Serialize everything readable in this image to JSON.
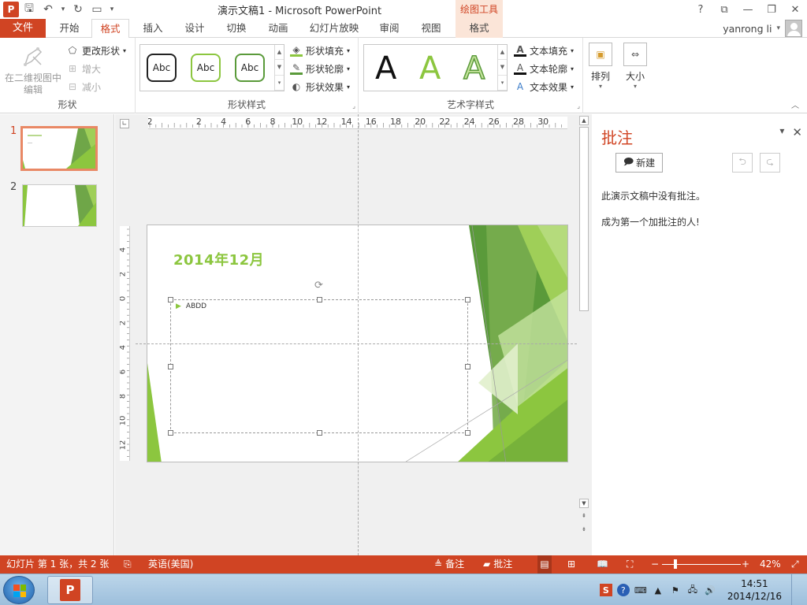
{
  "titlebar": {
    "app_icon": "P",
    "title": "演示文稿1 - Microsoft PowerPoint",
    "context_label": "绘图工具",
    "qat_icons": [
      "save-icon",
      "undo-icon",
      "redo-icon",
      "slideshow-icon",
      "customize-icon"
    ],
    "window_controls": [
      "?",
      "⧉",
      "—",
      "❐",
      "✕"
    ]
  },
  "tabs": {
    "file": "文件",
    "items": [
      "开始",
      "格式",
      "插入",
      "设计",
      "切换",
      "动画",
      "幻灯片放映",
      "审阅",
      "视图",
      "格式"
    ],
    "user": "yanrong li"
  },
  "ribbon": {
    "shape_group": {
      "edit_3d": "在二维视图中编辑",
      "change_shape": "更改形状",
      "increase": "增大",
      "decrease": "减小",
      "label": "形状"
    },
    "shape_styles": {
      "samples": [
        "Abc",
        "Abc",
        "Abc"
      ],
      "fill": "形状填充",
      "outline": "形状轮廓",
      "effects": "形状效果",
      "label": "形状样式"
    },
    "wordart": {
      "samples": [
        "A",
        "A",
        "A"
      ],
      "text_fill": "文本填充",
      "text_outline": "文本轮廓",
      "text_effects": "文本效果",
      "label": "艺术字样式"
    },
    "arrange": "排列",
    "size": "大小"
  },
  "thumbnails": {
    "numbers": [
      "1",
      "2"
    ]
  },
  "slide": {
    "date": "2014年12月",
    "bullet_text": "ABDD"
  },
  "ruler": {
    "h_labels": [
      "2",
      "2",
      "4",
      "6",
      "8",
      "10",
      "12",
      "14",
      "16",
      "18",
      "20",
      "22",
      "24",
      "26",
      "28",
      "30"
    ],
    "v_labels": [
      "4",
      "2",
      "0",
      "2",
      "4",
      "6",
      "8",
      "10",
      "12"
    ]
  },
  "comments": {
    "title": "批注",
    "new_label": "新建",
    "empty_line1": "此演示文稿中没有批注。",
    "empty_line2": "成为第一个加批注的人!"
  },
  "statusbar": {
    "slide_info": "幻灯片 第 1 张，共 2 张",
    "language": "英语(美国)",
    "notes": "备注",
    "comments": "批注",
    "zoom": "42%"
  },
  "taskbar": {
    "time": "14:51",
    "date": "2014/12/16"
  },
  "colors": {
    "accent": "#d04423",
    "green": "#8cc63f",
    "dark_green": "#5a9a3a"
  }
}
